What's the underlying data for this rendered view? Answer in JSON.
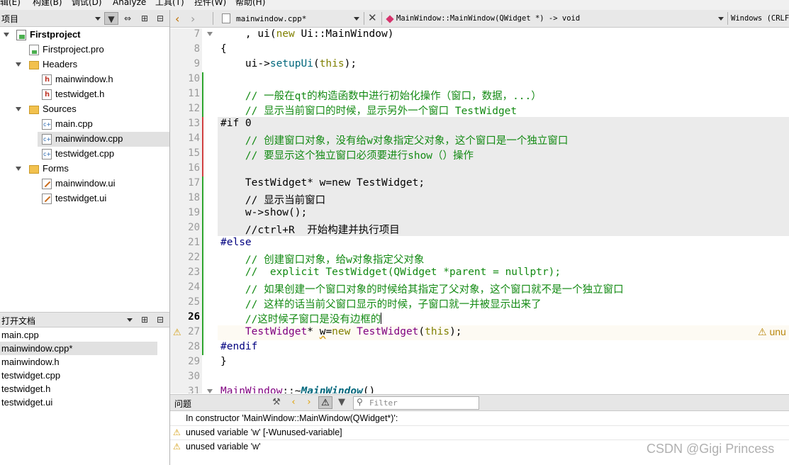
{
  "menubar": [
    "辑(E)",
    "构建(B)",
    "调试(D)",
    "Analyze",
    "工具(T)",
    "控件(W)",
    "帮助(H)"
  ],
  "project_panel": {
    "title": "项目",
    "tree": [
      {
        "label": "Firstproject",
        "icon": "project-icon"
      },
      {
        "label": "Firstproject.pro",
        "icon": "pro-file-icon"
      },
      {
        "label": "Headers",
        "icon": "headers-folder-icon"
      },
      {
        "label": "mainwindow.h",
        "icon": "header-file-icon"
      },
      {
        "label": "testwidget.h",
        "icon": "header-file-icon"
      },
      {
        "label": "Sources",
        "icon": "sources-folder-icon"
      },
      {
        "label": "main.cpp",
        "icon": "cpp-file-icon"
      },
      {
        "label": "mainwindow.cpp",
        "icon": "cpp-file-icon"
      },
      {
        "label": "testwidget.cpp",
        "icon": "cpp-file-icon"
      },
      {
        "label": "Forms",
        "icon": "forms-folder-icon"
      },
      {
        "label": "mainwindow.ui",
        "icon": "ui-file-icon"
      },
      {
        "label": "testwidget.ui",
        "icon": "ui-file-icon"
      }
    ]
  },
  "open_docs": {
    "title": "打开文档",
    "items": [
      "main.cpp",
      "mainwindow.cpp*",
      "mainwindow.h",
      "testwidget.cpp",
      "testwidget.h",
      "testwidget.ui"
    ]
  },
  "editor_toolbar": {
    "file_name": "mainwindow.cpp*",
    "symbol": "MainWindow::MainWindow(QWidget *) -> void",
    "encoding": "Windows (CRLF)"
  },
  "code": {
    "l7": "7",
    "l8": "8",
    "l9": "9",
    "l10": "10",
    "l11": "11",
    "l12": "12",
    "l13": "13",
    "l14": "14",
    "l15": "15",
    "l16": "16",
    "l17": "17",
    "l18": "18",
    "l19": "19",
    "l20": "20",
    "l21": "21",
    "l22": "22",
    "l23": "23",
    "l24": "24",
    "l25": "25",
    "l26": "26",
    "l27": "27",
    "l28": "28",
    "l29": "29",
    "l30": "30",
    "l31": "31",
    "c7a": "    , ui(",
    "c7b": "new",
    "c7c": " Ui::MainWindow)",
    "c8": "{",
    "c9a": "    ui->",
    "c9b": "setupUi",
    "c9c": "(",
    "c9d": "this",
    "c9e": ");",
    "c11": "    // 一般在qt的构造函数中进行初始化操作（窗口，数据，...）",
    "c12": "    // 显示当前窗口的时候，显示另外一个窗口 TestWidget",
    "c13": "#if 0",
    "c14": "    // 创建窗口对象，没有给w对象指定父对象，这个窗口是一个独立窗口",
    "c15": "    // 要显示这个独立窗口必须要进行show（）操作",
    "c17": "    TestWidget* w=new TestWidget;",
    "c18": "    // 显示当前窗口",
    "c19": "    w->show();",
    "c20": "    //ctrl+R  开始构建并执行项目",
    "c21": "#else",
    "c22": "    // 创建窗口对象，给w对象指定父对象",
    "c23": "    //  explicit TestWidget(QWidget *parent = nullptr);",
    "c24": "    // 如果创建一个窗口对象的时候给其指定了父对象，这个窗口就不是一个独立窗口",
    "c25": "    // 这样的话当前父窗口显示的时候，子窗口就一并被显示出来了",
    "c26": "    //这时候子窗口是没有边框的",
    "c27a": "    ",
    "c27b": "TestWidget",
    "c27c": "* ",
    "c27d": "w",
    "c27e": "=",
    "c27f": "new",
    "c27g": " ",
    "c27h": "TestWidget",
    "c27i": "(",
    "c27j": "this",
    "c27k": ");",
    "c27warn": "⚠ unu",
    "c28": "#endif",
    "c29": "}",
    "c31a": "MainWindow",
    "c31b": "::~",
    "c31c": "MainWindow",
    "c31d": "()"
  },
  "issues_panel": {
    "title": "问题",
    "filter_placeholder": "Filter",
    "rows": [
      "In constructor 'MainWindow::MainWindow(QWidget*)':",
      "unused variable 'w' [-Wunused-variable]",
      "unused variable 'w'"
    ]
  },
  "watermark": "CSDN @Gigi Princess",
  "colors": {
    "comment": "#138a13",
    "keyword": "#808000",
    "preprocessor": "#000080",
    "type": "#800080",
    "function": "#00677c",
    "warning": "#d4a017"
  }
}
